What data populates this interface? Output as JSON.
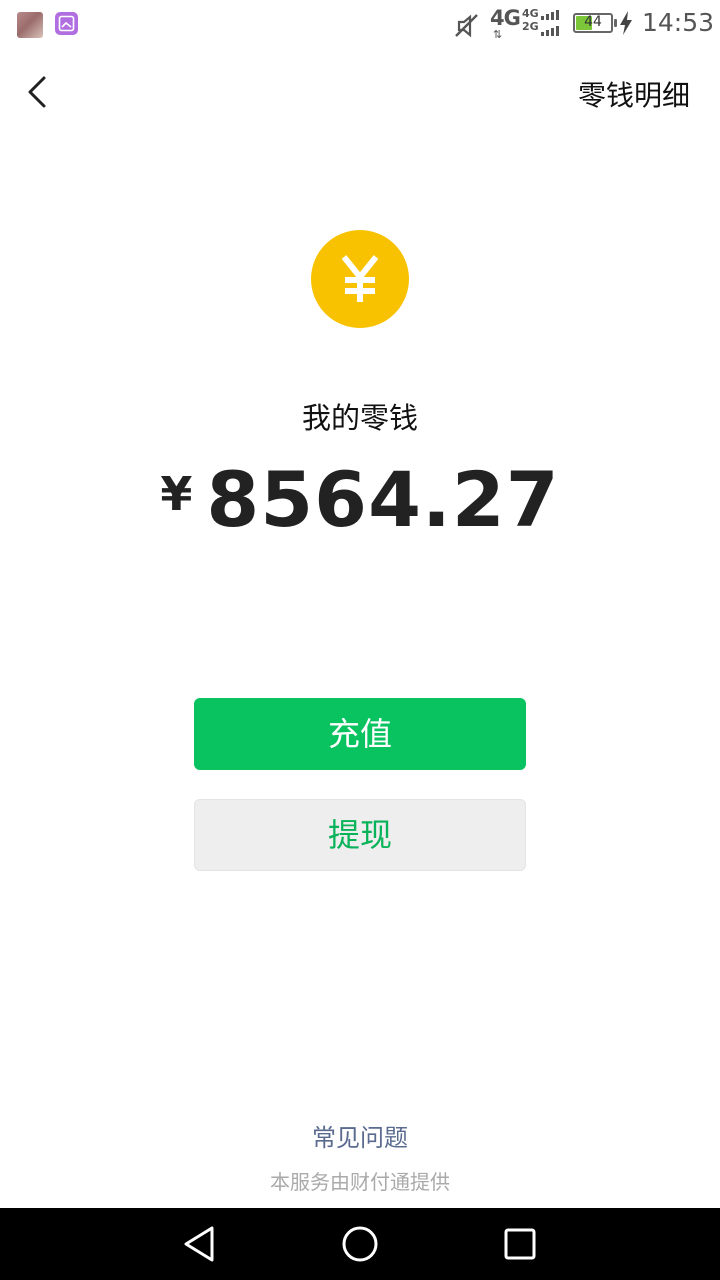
{
  "status_bar": {
    "network_primary": "4G",
    "network_secondary_top": "4G",
    "network_secondary_bottom": "2G",
    "arrows": "⇅",
    "battery_level": "44",
    "battery_percent": 44,
    "charging": true,
    "time": "14:53"
  },
  "header": {
    "back_icon": "chevron-left-icon",
    "detail_link": "零钱明细"
  },
  "wallet": {
    "icon": "yen-coin-icon",
    "icon_color": "#f9c200",
    "label": "我的零钱",
    "currency_symbol": "¥",
    "amount": "8564.27"
  },
  "actions": {
    "recharge_label": "充值",
    "withdraw_label": "提现",
    "accent_color": "#09c260"
  },
  "footer": {
    "faq_link": "常见问题",
    "provider_text": "本服务由财付通提供"
  },
  "nav_bar": {
    "back_icon": "triangle-back-icon",
    "home_icon": "circle-home-icon",
    "recent_icon": "square-recent-icon"
  }
}
